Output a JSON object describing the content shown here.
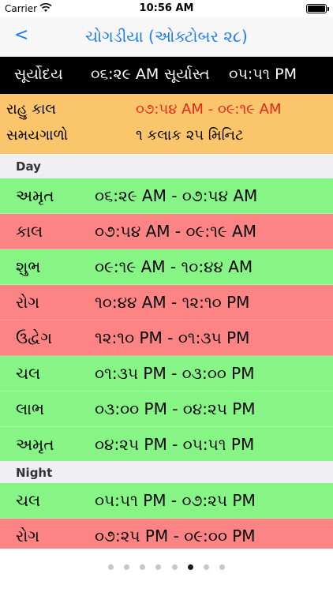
{
  "status": {
    "carrier": "Carrier",
    "time": "10:56 AM"
  },
  "nav": {
    "back": "<",
    "title": "ચોગડીયા (ઓક્ટોબર ૨૮)"
  },
  "sun": {
    "sunrise_label": "સૂર્યોદય",
    "sunrise_time": "૦૬:૨૯ AM",
    "sunset_label": "સૂર્યાસ્ત",
    "sunset_time": "૦૫:૫૧ PM"
  },
  "info": {
    "rahu_label": "રાહુ કાલ",
    "rahu_value": "૦૭:૫૪ AM - ૦૯:૧૯ AM",
    "duration_label": "સમયગાળો",
    "duration_value": "૧ કલાક ૨૫ મિનિટ"
  },
  "day": {
    "header": "Day",
    "rows": [
      {
        "name": "અમૃત",
        "range": "૦૬:૨૯ AM - ૦૭:૫૪ AM"
      },
      {
        "name": "કાલ",
        "range": "૦૭:૫૪ AM - ૦૯:૧૯ AM"
      },
      {
        "name": "શુભ",
        "range": "૦૯:૧૯ AM - ૧૦:૪૪ AM"
      },
      {
        "name": "રોગ",
        "range": "૧૦:૪૪ AM - ૧૨:૧૦ PM"
      },
      {
        "name": "ઉદ્વેગ",
        "range": "૧૨:૧૦ PM - ૦૧:૩૫ PM"
      },
      {
        "name": "ચલ",
        "range": "૦૧:૩૫ PM - ૦૩:૦૦ PM"
      },
      {
        "name": "લાભ",
        "range": "૦૩:૦૦ PM - ૦૪:૨૫ PM"
      },
      {
        "name": "અમૃત",
        "range": "૦૪:૨૫ PM - ૦૫:૫૧ PM"
      }
    ]
  },
  "night": {
    "header": "Night",
    "rows": [
      {
        "name": "ચલ",
        "range": "૦૫:૫૧ PM - ૦૭:૨૫ PM"
      },
      {
        "name": "રોગ",
        "range": "૦૭:૨૫ PM - ૦૯:૦૦ PM"
      }
    ]
  },
  "colors": {
    "good": "#86f586",
    "bad": "#fd8484",
    "accent": "#1e7cf2",
    "info_bg": "#fbc56b"
  },
  "pager": {
    "page_count": 8,
    "active_index": 5
  }
}
